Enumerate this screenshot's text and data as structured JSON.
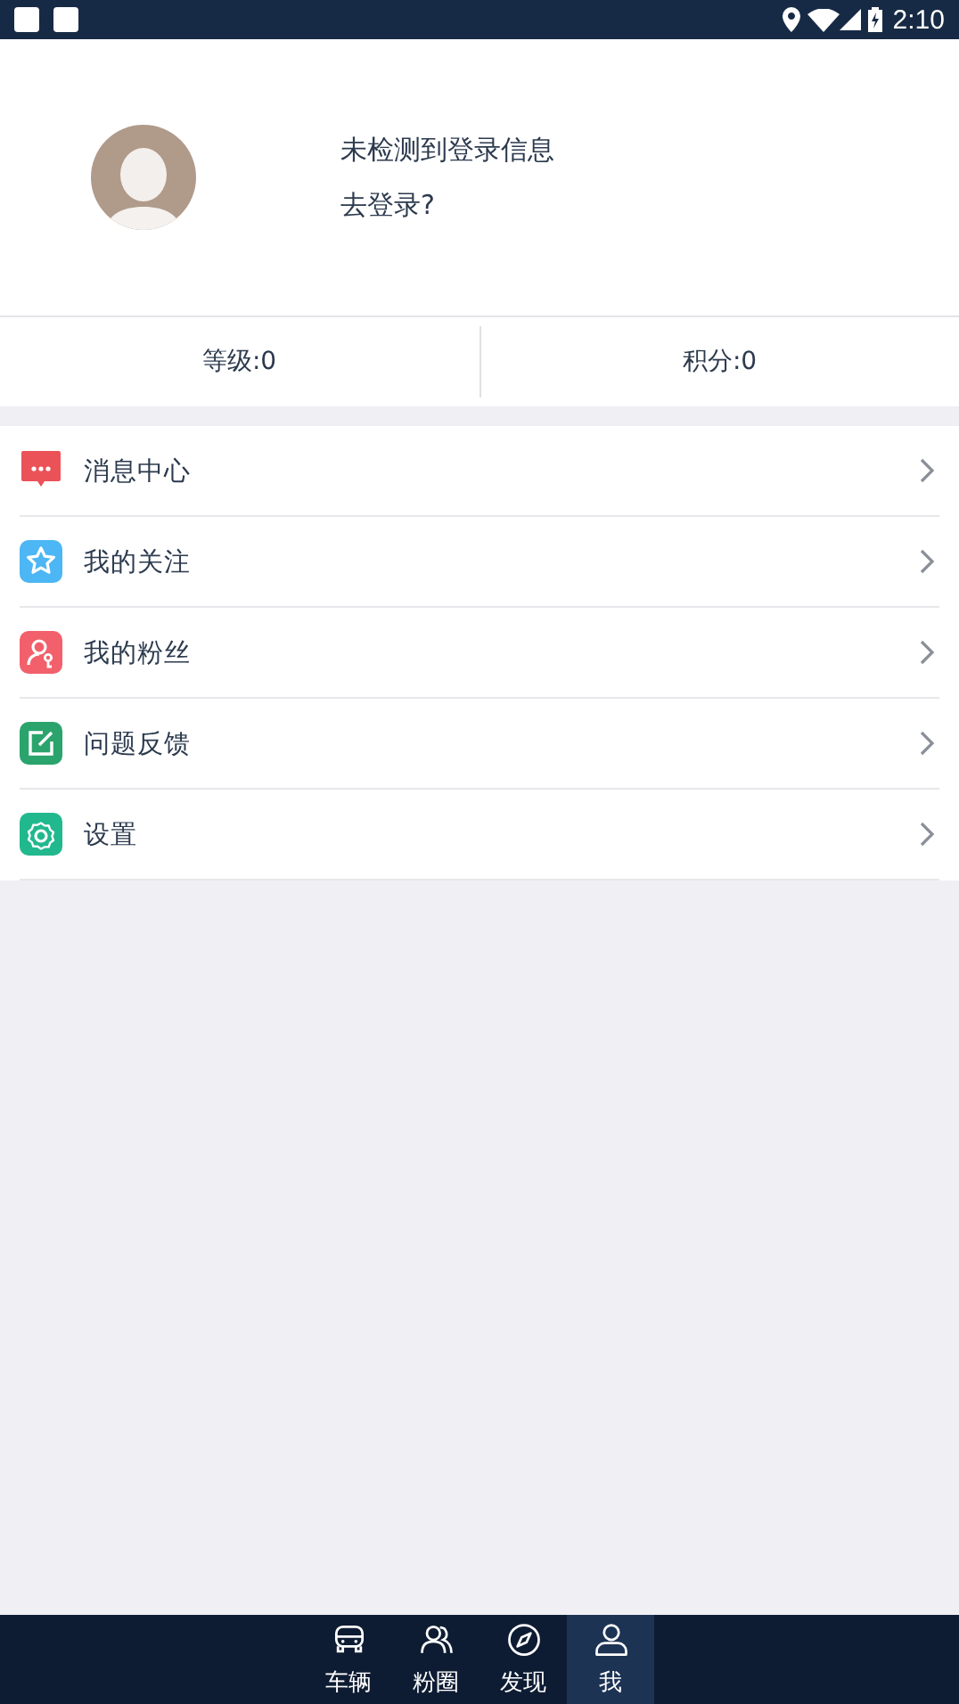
{
  "status_bar": {
    "time": "2:10"
  },
  "profile": {
    "message": "未检测到登录信息",
    "login_link": "去登录?"
  },
  "stats": [
    {
      "label": "等级:0"
    },
    {
      "label": "积分:0"
    }
  ],
  "menu": [
    {
      "kind": "message",
      "label": "消息中心",
      "color": "#ea5258"
    },
    {
      "kind": "star",
      "label": "我的关注",
      "color": "#4db6f4"
    },
    {
      "kind": "fans",
      "label": "我的粉丝",
      "color": "#f2606b"
    },
    {
      "kind": "feedback",
      "label": "问题反馈",
      "color": "#2aa46c"
    },
    {
      "kind": "settings",
      "label": "设置",
      "color": "#22b88e"
    }
  ],
  "tab_bar": [
    {
      "kind": "car",
      "label": "车辆",
      "selected": false
    },
    {
      "kind": "people",
      "label": "粉圈",
      "selected": false
    },
    {
      "kind": "compass",
      "label": "发现",
      "selected": false
    },
    {
      "kind": "person",
      "label": "我",
      "selected": true
    }
  ]
}
